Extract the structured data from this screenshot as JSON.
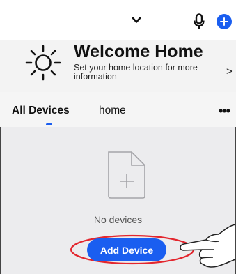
{
  "header": {
    "dropdown_icon": "chevron-down-icon",
    "mic_icon": "microphone-icon",
    "add_icon": "plus-circle-icon"
  },
  "welcome": {
    "icon": "sun-icon",
    "title": "Welcome Home",
    "subtitle": "Set your home location for more information",
    "chevron": ">"
  },
  "tabs": [
    {
      "label": "All Devices",
      "active": true
    },
    {
      "label": "home",
      "active": false
    }
  ],
  "tabs_more": "•••",
  "empty": {
    "icon": "add-file-icon",
    "text": "No devices",
    "button_label": "Add Device"
  },
  "colors": {
    "accent": "#1a5ef0",
    "annotation": "#e3262e"
  }
}
